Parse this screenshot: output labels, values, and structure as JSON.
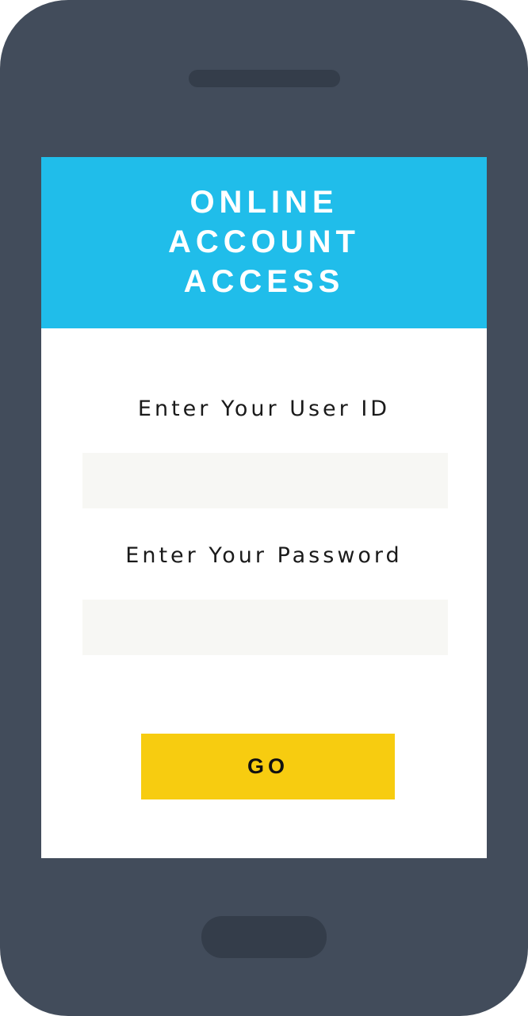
{
  "header": {
    "title_lines": [
      "ONLINE",
      "ACCOUNT",
      "ACCESS"
    ]
  },
  "form": {
    "user_id_label": "Enter Your User ID",
    "user_id_value": "",
    "password_label": "Enter Your Password",
    "password_value": "",
    "go_label": "GO"
  },
  "colors": {
    "phone_body": "#424c5b",
    "header_bg": "#20bdea",
    "button_bg": "#f7cc10",
    "field_bg": "#f7f7f4"
  }
}
